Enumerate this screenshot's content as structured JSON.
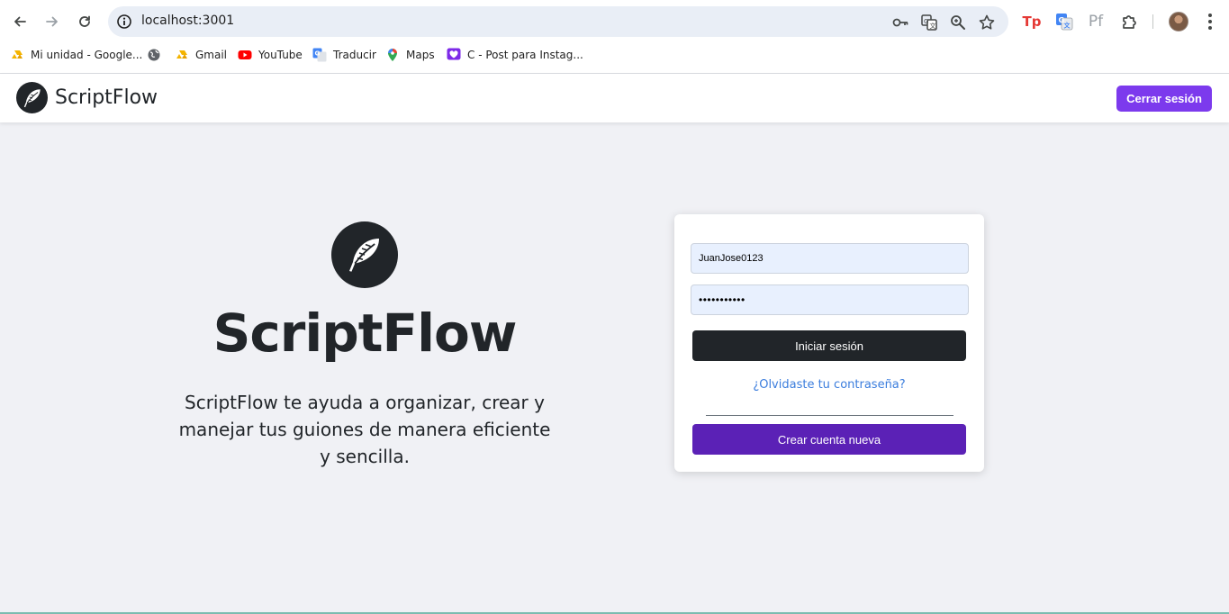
{
  "browser": {
    "url": "localhost:3001",
    "bookmarks": [
      {
        "label": "Mi unidad - Google...",
        "icon": "google-drive-icon"
      },
      {
        "label": "",
        "icon": "globe-icon"
      },
      {
        "label": "Gmail",
        "icon": "gmail-icon"
      },
      {
        "label": "YouTube",
        "icon": "youtube-icon"
      },
      {
        "label": "Traducir",
        "icon": "google-translate-icon"
      },
      {
        "label": "Maps",
        "icon": "google-maps-icon"
      },
      {
        "label": "C - Post para Instag...",
        "icon": "canva-heart-icon"
      }
    ],
    "extensions": {
      "tp_label": "Tp",
      "pf_label": "Pf"
    }
  },
  "navbar": {
    "brand": "ScriptFlow",
    "logout_label": "Cerrar sesión",
    "accent": "#7c3aed"
  },
  "hero": {
    "title": "ScriptFlow",
    "description": "ScriptFlow te ayuda a organizar, crear y manejar tus guiones de manera eficiente y sencilla."
  },
  "login": {
    "username_value": "JuanJose0123",
    "password_mask": "•••••••••••",
    "login_label": "Iniciar sesión",
    "forgot_label": "¿Olvidaste tu contraseña?",
    "create_label": "Crear cuenta nueva",
    "login_color": "#212529",
    "create_color": "#5b21b6"
  }
}
